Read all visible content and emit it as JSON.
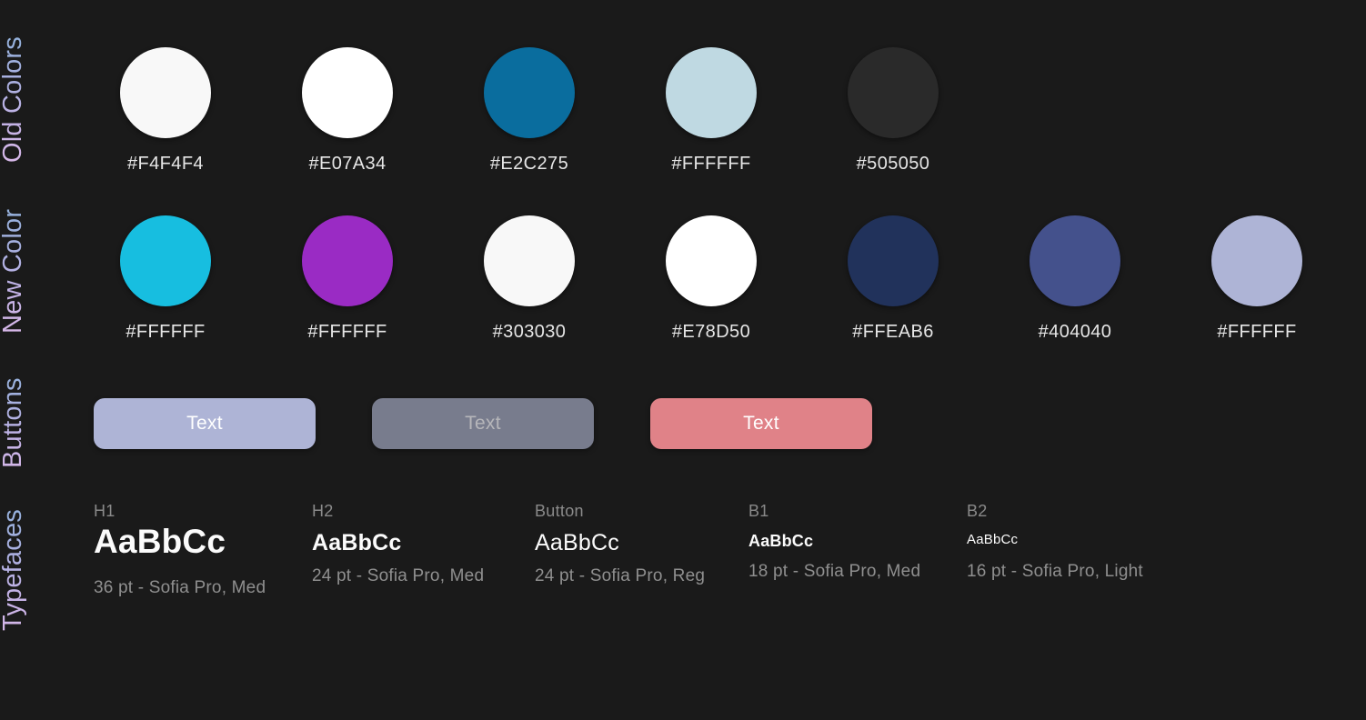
{
  "sections": {
    "old_colors": {
      "label": "Old Colors",
      "swatches": [
        {
          "hex_label": "#F4F4F4",
          "fill": "#f8f8f8"
        },
        {
          "hex_label": "#E07A34",
          "fill": "#ffffff"
        },
        {
          "hex_label": "#E2C275",
          "fill": "#0a6d9e"
        },
        {
          "hex_label": "#FFFFFF",
          "fill": "#bfd9e2"
        },
        {
          "hex_label": "#505050",
          "fill": "#2a2a2a"
        }
      ]
    },
    "new_color": {
      "label": "New Color",
      "swatches": [
        {
          "hex_label": "#FFFFFF",
          "fill": "#17bee0"
        },
        {
          "hex_label": "#FFFFFF",
          "fill": "#9a2bc4"
        },
        {
          "hex_label": "#303030",
          "fill": "#f8f8f8"
        },
        {
          "hex_label": "#E78D50",
          "fill": "#ffffff"
        },
        {
          "hex_label": "#FFEAB6",
          "fill": "#21325b"
        },
        {
          "hex_label": "#404040",
          "fill": "#44518c"
        },
        {
          "hex_label": "#FFFFFF",
          "fill": "#aeb4d6"
        }
      ]
    },
    "buttons": {
      "label": "Buttons",
      "items": [
        {
          "text": "Text",
          "fill": "#aeb4d6",
          "text_color": "#ffffff",
          "state": "default"
        },
        {
          "text": "Text",
          "fill": "#787c8d",
          "text_color": "#b6b6ba",
          "state": "disabled"
        },
        {
          "text": "Text",
          "fill": "#e08288",
          "text_color": "#ffffff",
          "state": "danger"
        }
      ]
    },
    "typefaces": {
      "label": "Typefaces",
      "items": [
        {
          "name": "H1",
          "sample": "AaBbCc",
          "spec": "36 pt - Sofia Pro, Med"
        },
        {
          "name": "H2",
          "sample": "AaBbCc",
          "spec": "24 pt - Sofia Pro, Med"
        },
        {
          "name": "Button",
          "sample": "AaBbCc",
          "spec": "24 pt - Sofia Pro, Reg"
        },
        {
          "name": "B1",
          "sample": "AaBbCc",
          "spec": "18 pt - Sofia Pro, Med"
        },
        {
          "name": "B2",
          "sample": "AaBbCc",
          "spec": "16 pt - Sofia Pro, Light"
        }
      ]
    }
  }
}
